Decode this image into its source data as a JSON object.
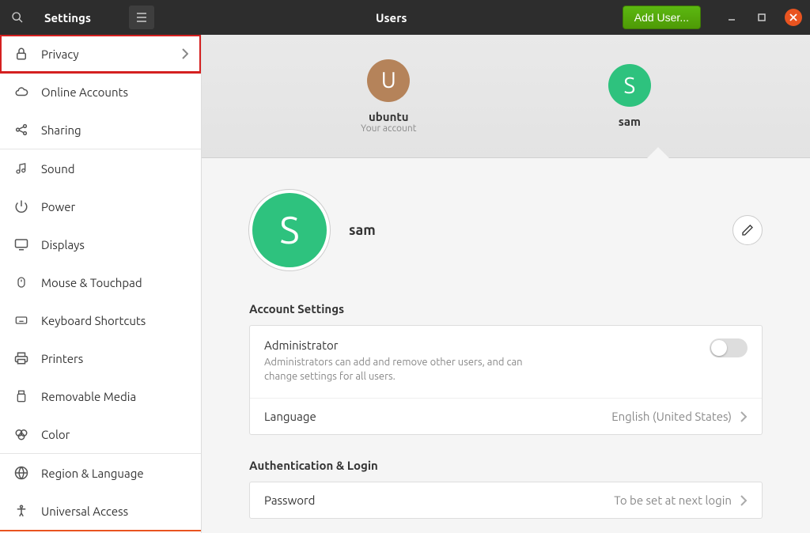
{
  "titlebar": {
    "app_title": "Settings",
    "panel_title": "Users",
    "add_user_label": "Add User..."
  },
  "sidebar": {
    "items": [
      {
        "icon": "lock",
        "label": "Privacy",
        "has_chevron": true,
        "highlight": true
      },
      {
        "icon": "cloud",
        "label": "Online Accounts"
      },
      {
        "icon": "share",
        "label": "Sharing"
      },
      {
        "icon": "note",
        "label": "Sound"
      },
      {
        "icon": "power",
        "label": "Power"
      },
      {
        "icon": "display",
        "label": "Displays"
      },
      {
        "icon": "mouse",
        "label": "Mouse & Touchpad"
      },
      {
        "icon": "keyboard",
        "label": "Keyboard Shortcuts"
      },
      {
        "icon": "printer",
        "label": "Printers"
      },
      {
        "icon": "usb",
        "label": "Removable Media"
      },
      {
        "icon": "color",
        "label": "Color"
      },
      {
        "icon": "globe",
        "label": "Region & Language"
      },
      {
        "icon": "accessibility",
        "label": "Universal Access"
      }
    ]
  },
  "user_strip": {
    "users": [
      {
        "initial": "U",
        "name": "ubuntu",
        "sub": "Your account",
        "color": "brown"
      },
      {
        "initial": "S",
        "name": "sam",
        "sub": "",
        "color": "green",
        "selected": true
      }
    ]
  },
  "profile": {
    "initial": "S",
    "name": "sam"
  },
  "account_settings": {
    "title": "Account Settings",
    "admin_label": "Administrator",
    "admin_desc": "Administrators can add and remove other users, and can change settings for all users.",
    "admin_on": false,
    "language_label": "Language",
    "language_value": "English (United States)"
  },
  "auth": {
    "title": "Authentication & Login",
    "password_label": "Password",
    "password_value": "To be set at next login"
  }
}
